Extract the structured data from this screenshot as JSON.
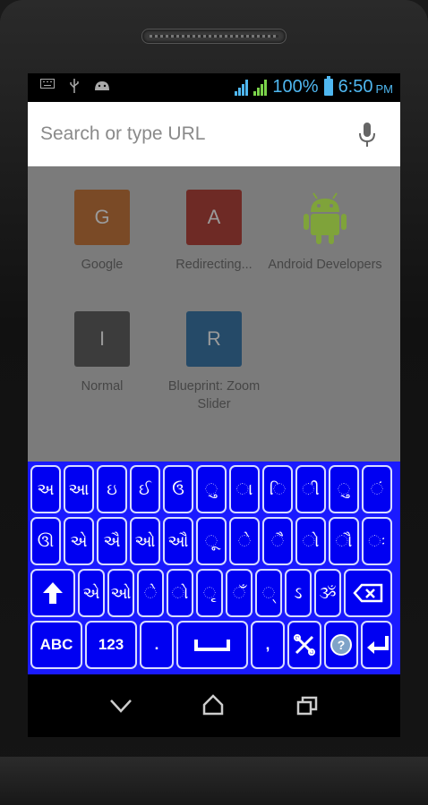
{
  "status_bar": {
    "left_icons": [
      "keyboard-icon",
      "usb-icon",
      "android-icon"
    ],
    "battery_percent": "100%",
    "time": "6:50",
    "ampm": "PM",
    "accent_color": "#4fb7f0"
  },
  "browser": {
    "search_placeholder": "Search or type URL",
    "tiles": [
      {
        "letter": "G",
        "label": "Google",
        "color": "#7a4a26"
      },
      {
        "letter": "A",
        "label": "Redirecting...",
        "color": "#6e2a25"
      },
      {
        "letter": "",
        "label": "Android Developers",
        "icon": "android-robot-icon",
        "color": "#7fa33a"
      },
      {
        "letter": "I",
        "label": "Normal",
        "color": "#3c3c3c"
      },
      {
        "letter": "R",
        "label": "Blueprint: Zoom Slider",
        "color": "#254a68"
      }
    ]
  },
  "keyboard": {
    "row1": [
      "અ",
      "આ",
      "ઇ",
      "ઈ",
      "ઉ",
      "ુ",
      "ા",
      "િ",
      "ી",
      "ુ",
      "ં"
    ],
    "row2": [
      "ઊ",
      "એ",
      "ઐ",
      "ઓ",
      "ઔ",
      "ૂ",
      "ે",
      "ૈ",
      "ો",
      "ૌ",
      "ઃ"
    ],
    "row3": [
      "એ",
      "ઓ",
      "ે",
      "ો",
      "ૃ",
      "ઁ",
      "્",
      "ઽ",
      "ૐ"
    ],
    "row4": {
      "abc": "ABC",
      "num": "123",
      "period": ".",
      "comma": ","
    },
    "colors": {
      "background": "#1a1aff",
      "key": "#0000f2",
      "key_border": "#d8dcff"
    }
  },
  "nav": [
    "back-icon",
    "home-icon",
    "recents-icon"
  ]
}
